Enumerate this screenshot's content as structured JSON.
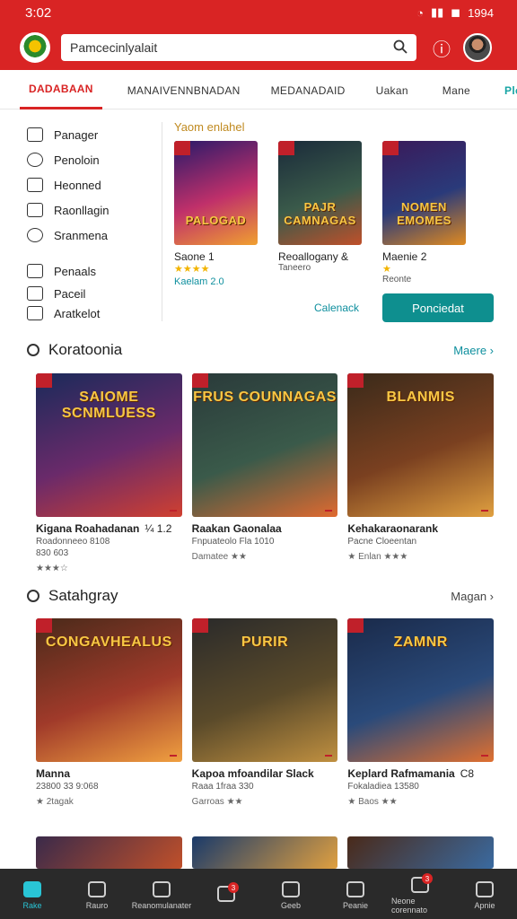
{
  "status": {
    "time": "3:02",
    "right": "1994",
    "battery": "◼"
  },
  "search": {
    "value": "Pamcecinlyalait"
  },
  "tabs": [
    {
      "label": "DADABAAN"
    },
    {
      "label": "MANAIVENNBNADAN"
    },
    {
      "label": "MEDANADAID"
    },
    {
      "label": "Uakan"
    },
    {
      "label": "Mane"
    },
    {
      "label": "Pleki"
    }
  ],
  "sidebar": [
    {
      "label": "Panager",
      "icon": "home-icon"
    },
    {
      "label": "Penoloin",
      "icon": "chat-icon"
    },
    {
      "label": "Heonned",
      "icon": "mail-icon"
    },
    {
      "label": "Raonllagin",
      "icon": "calendar-icon"
    },
    {
      "label": "Sranmena",
      "icon": "users-icon"
    },
    {
      "label": "Penaals",
      "icon": "card-icon"
    },
    {
      "label": "Paceil",
      "icon": "flag-icon"
    },
    {
      "label": "Aratkelot",
      "icon": "doc-icon"
    }
  ],
  "featured": {
    "title": "Yaom enlahel",
    "cards": [
      {
        "art": "PALOGAD",
        "label": "Saone 1",
        "stars": "★★★★",
        "sub": "",
        "teal": "Kaelam 2.0",
        "colors": [
          "#2a1a6a",
          "#c0306a",
          "#f0a030"
        ]
      },
      {
        "art": "PAJR CAMNAGAS",
        "label": "Reoallogany &",
        "stars": "",
        "sub": "Taneero",
        "teal": "",
        "colors": [
          "#1a2a3a",
          "#3a5a4a",
          "#c0502a"
        ]
      },
      {
        "art": "NOMEN EMOMES",
        "label": "Maenie 2",
        "stars": "★",
        "sub": "Reonte",
        "teal": "",
        "colors": [
          "#3a1a5a",
          "#2a3a7a",
          "#e08a20"
        ]
      }
    ]
  },
  "featured_actions": {
    "secondary": "Calenack",
    "primary": "Ponciedat"
  },
  "section1": {
    "title": "Koratoonia",
    "more": "Maere ›",
    "cards": [
      {
        "art": "SAIOME SCNMLUESS",
        "title": "Kigana Roahadanan",
        "extra": "¼ 1.2",
        "sub": "Roadonneeo 8108",
        "sub2": "830 603",
        "meta": "★★★☆",
        "colors": [
          "#1a2a5a",
          "#6a2a6a",
          "#d04030"
        ]
      },
      {
        "art": "FRUS COUNNAGAS",
        "title": "Raakan Gaonalaa",
        "extra": "",
        "sub": "Fnpuateolo Fla 1010",
        "sub2": "",
        "meta": "Damatee ★★",
        "colors": [
          "#2a3a3a",
          "#3a5a4a",
          "#e06a30"
        ]
      },
      {
        "art": "BLANMIS",
        "title": "Kehakaraonarank",
        "extra": "",
        "sub": "Pacne Cloeentan",
        "sub2": "",
        "meta": "★ Enlan ★★★",
        "colors": [
          "#3a2a1a",
          "#7a4020",
          "#e0a040"
        ]
      }
    ]
  },
  "section2": {
    "title": "Satahgray",
    "more": "Magan ›",
    "cards": [
      {
        "art": "CONGAVHEALUS",
        "title": "Manna",
        "extra": "",
        "sub": "23800 33 9:068",
        "sub2": "",
        "meta": "★ 2tagak",
        "colors": [
          "#4a2a1a",
          "#a03a2a",
          "#f0a040"
        ]
      },
      {
        "art": "PURIR",
        "title": "Kapoa mfoandilar Slack",
        "extra": "",
        "sub": "Raaa 1fraa 330",
        "sub2": "",
        "meta": "Garroas ★★",
        "colors": [
          "#2a2a2a",
          "#5a4a2a",
          "#c09040"
        ]
      },
      {
        "art": "ZAMNR",
        "title": "Keplard Rafmamania",
        "extra": "C8",
        "sub": "Fokaladiea 13580",
        "sub2": "",
        "meta": "★ Baos ★★",
        "colors": [
          "#1a2a4a",
          "#2a4a7a",
          "#e07030"
        ]
      }
    ]
  },
  "bottom_nav": [
    {
      "label": "Rake",
      "active": true,
      "badge": ""
    },
    {
      "label": "Rauro",
      "active": false,
      "badge": ""
    },
    {
      "label": "Reanomulanater",
      "active": false,
      "badge": ""
    },
    {
      "label": "",
      "active": false,
      "badge": "3"
    },
    {
      "label": "Geeb",
      "active": false,
      "badge": ""
    },
    {
      "label": "Peanie",
      "active": false,
      "badge": ""
    },
    {
      "label": "Neone corennato",
      "active": false,
      "badge": "3"
    },
    {
      "label": "Apnie",
      "active": false,
      "badge": ""
    }
  ]
}
